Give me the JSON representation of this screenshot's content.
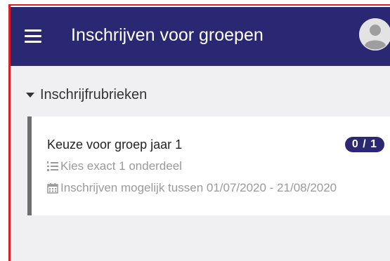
{
  "appbar": {
    "title": "Inschrijven voor groepen",
    "menu_icon": "hamburger-menu-icon",
    "avatar_icon": "user-avatar-icon",
    "background_color": "#2a2873"
  },
  "section": {
    "title": "Inschrijfrubrieken",
    "expanded": true,
    "toggle_icon": "caret-down-icon"
  },
  "card": {
    "title": "Keuze voor groep jaar 1",
    "badge": "0 / 1",
    "badge_color": "#2a2873",
    "rule_icon": "ordered-list-icon",
    "rule_text": "Kies exact 1 onderdeel",
    "period_icon": "calendar-icon",
    "period_text": "Inschrijven mogelijk tussen 01/07/2020 - 21/08/2020"
  }
}
